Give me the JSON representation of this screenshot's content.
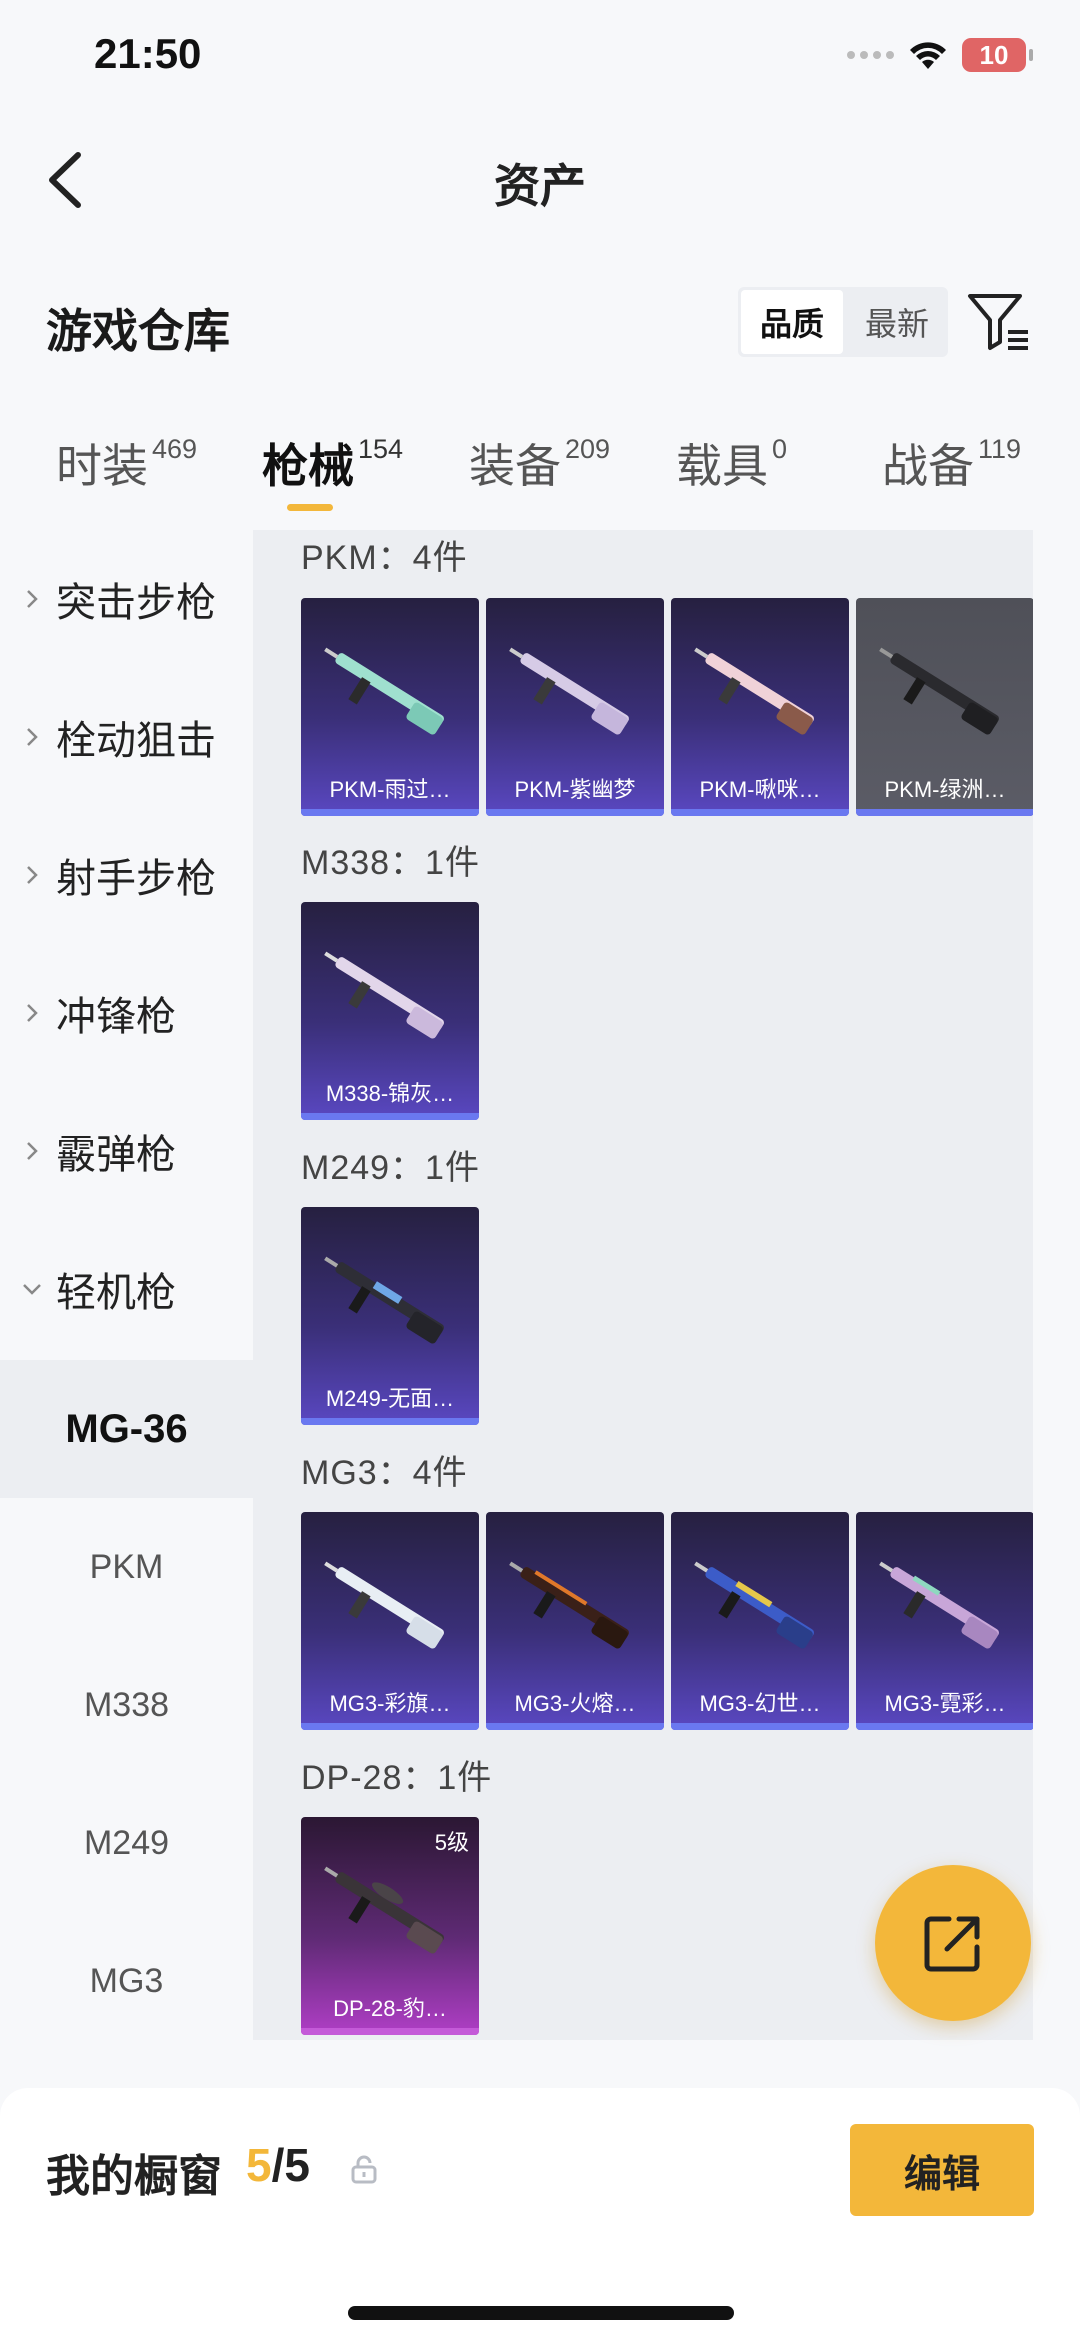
{
  "status": {
    "time": "21:50",
    "battery": "10"
  },
  "header": {
    "title": "资产"
  },
  "section": {
    "title": "游戏仓库",
    "sort_options": [
      "品质",
      "最新"
    ],
    "active_sort": "品质"
  },
  "tabs": [
    {
      "label": "时装",
      "count": "469"
    },
    {
      "label": "枪械",
      "count": "154",
      "active": true
    },
    {
      "label": "装备",
      "count": "209"
    },
    {
      "label": "载具",
      "count": "0"
    },
    {
      "label": "战备",
      "count": "119"
    }
  ],
  "sidenav": {
    "categories": [
      "突击步枪",
      "栓动狙击",
      "射手步枪",
      "冲锋枪",
      "霰弹枪",
      "轻机枪"
    ],
    "subitems": [
      "MG-36",
      "PKM",
      "M338",
      "M249",
      "MG3"
    ],
    "selected": "MG-36"
  },
  "groups": [
    {
      "title": "PKM：4件",
      "items": [
        "PKM-雨过…",
        "PKM-紫幽梦",
        "PKM-啾咪…",
        "PKM-绿洲…"
      ]
    },
    {
      "title": "M338：1件",
      "items": [
        "M338-锦灰…"
      ]
    },
    {
      "title": "M249：1件",
      "items": [
        "M249-无面…"
      ]
    },
    {
      "title": "MG3：4件",
      "items": [
        "MG3-彩旗…",
        "MG3-火熔…",
        "MG3-幻世…",
        "MG3-霓彩…"
      ]
    },
    {
      "title": "DP-28：1件",
      "items": [
        "DP-28-豹…"
      ],
      "level": "5级"
    }
  ],
  "bottom": {
    "label": "我的橱窗",
    "count_current": "5",
    "count_total": "/5",
    "edit_label": "编辑"
  },
  "colors": {
    "accent": "#f3b73a",
    "card_purple": "#5a48c2",
    "card_pink": "#b03ec6",
    "card_gray": "#5b5c66"
  }
}
